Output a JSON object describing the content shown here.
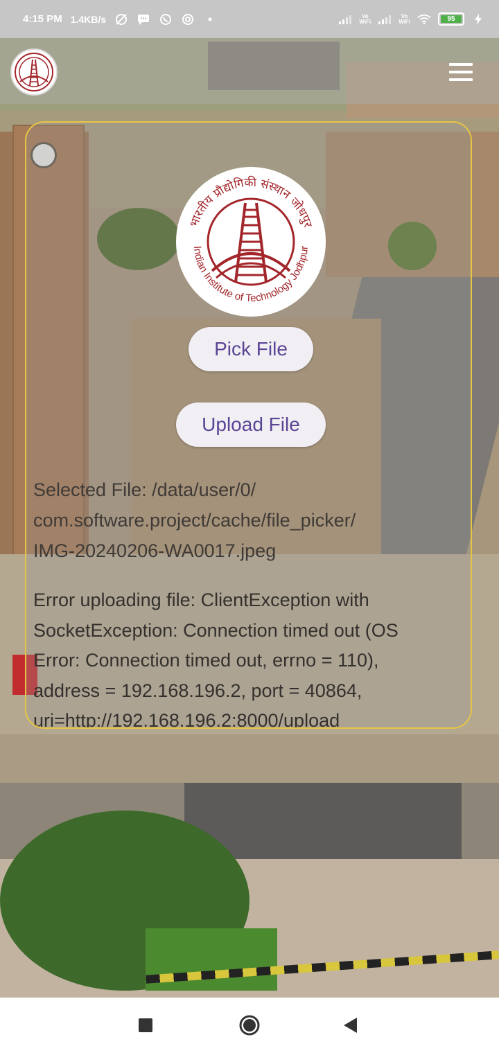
{
  "status_bar": {
    "time": "4:15 PM",
    "speed": "1.4KB/s",
    "battery": "95",
    "vowifi_1": "Vo\nWiFi",
    "vowifi_2": "Vo\nWiFi"
  },
  "app_bar": {
    "logo_icon": "iit-jodhpur-logo",
    "menu_icon": "hamburger-menu-icon"
  },
  "card": {
    "logo_icon": "iit-jodhpur-seal",
    "logo_hindi": "भारतीय प्रौद्योगिकी संस्थान जोधपुर",
    "logo_english": "Indian Institute of Technology Jodhpur",
    "pick_label": "Pick File",
    "upload_label": "Upload File",
    "selected_file": "Selected File: /data/user/0/\ncom.software.project/cache/file_picker/\nIMG-20240206-WA0017.jpeg",
    "error_message": "Error uploading file: ClientException with\nSocketException: Connection timed out (OS\nError: Connection timed out, errno = 110),\naddress = 192.168.196.2, port = 40864,\nuri=http://192.168.196.2:8000/upload"
  },
  "colors": {
    "accent": "#5a4595",
    "card_border": "#e7c544",
    "logo_red": "#a3262b"
  },
  "nav_bar": {
    "recents_icon": "square-recents-icon",
    "home_icon": "circle-home-icon",
    "back_icon": "triangle-back-icon"
  }
}
